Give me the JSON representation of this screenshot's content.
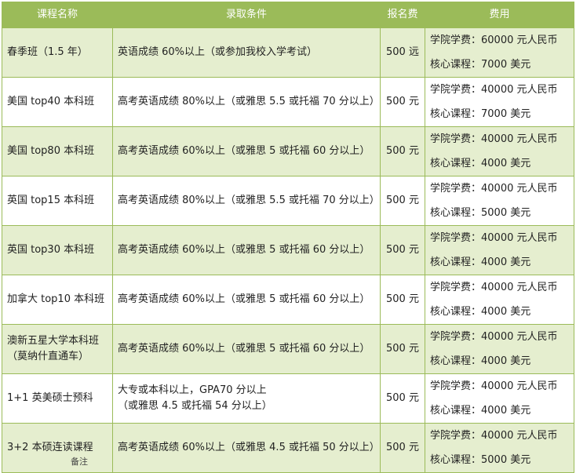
{
  "table": {
    "headers": [
      "课程名称",
      "录取条件",
      "报名费",
      "费用"
    ],
    "rows": [
      {
        "name": [
          "春季班（1.5 年）"
        ],
        "condition": [
          "英语成绩 60%以上（或参加我校入学考试）"
        ],
        "fee": "500 远",
        "costs": [
          "学院学费：60000 元人民币",
          "核心课程：7000 美元"
        ]
      },
      {
        "name": [
          "美国 top40 本科班"
        ],
        "condition": [
          "高考英语成绩 80%以上（或雅思 5.5 或托福 70 分以上）"
        ],
        "fee": "500 元",
        "costs": [
          "学院学费：40000 元人民币",
          "核心课程：7000 美元"
        ]
      },
      {
        "name": [
          "美国 top80 本科班"
        ],
        "condition": [
          "高考英语成绩 60%以上（或雅思 5 或托福 60 分以上）"
        ],
        "fee": "500 元",
        "costs": [
          "学院学费：40000 元人民币",
          "核心课程：4000 美元"
        ]
      },
      {
        "name": [
          "英国 top15 本科班"
        ],
        "condition": [
          "高考英语成绩 80%以上（或雅思 5.5 或托福 70 分以上）"
        ],
        "fee": "500 元",
        "costs": [
          "学院学费：40000 元人民币",
          "核心课程：5000 美元"
        ]
      },
      {
        "name": [
          "英国 top30 本科班"
        ],
        "condition": [
          "高考英语成绩 60%以上（或雅思 5 或托福 60 分以上）"
        ],
        "fee": "500 元",
        "costs": [
          "学院学费：40000 元人民币",
          "核心课程：4000 美元"
        ]
      },
      {
        "name": [
          "加拿大 top10 本科班"
        ],
        "condition": [
          "高考英语成绩 60%以上（或雅思 5 或托福 60 分以上）"
        ],
        "fee": "500 元",
        "costs": [
          "学院学费：40000 元人民币",
          "核心课程：4000 美元"
        ]
      },
      {
        "name": [
          "澳新五星大学本科班",
          "（莫纳什直通车）"
        ],
        "condition": [
          "高考英语成绩 60%以上（或雅思 5 或托福 60 分以上）"
        ],
        "fee": "500 元",
        "costs": [
          "学院学费：40000 元人民币",
          "核心课程：4000 美元"
        ]
      },
      {
        "name": [
          "1+1 英美硕士预科"
        ],
        "condition": [
          "大专或本科以上，GPA70 分以上",
          "（或雅思 4.5 或托福 54 分以上）"
        ],
        "fee": "500 元",
        "costs": [
          "学院学费：40000 元人民币",
          "核心课程：4000 美元"
        ]
      },
      {
        "name": [
          "3+2 本硕连读课程"
        ],
        "condition": [
          "高考英语成绩 60%以上（或雅思 4.5 或托福 50 分以上）"
        ],
        "fee": "500 元",
        "costs": [
          "学院学费：40000 元人民币",
          "核心课程：5000 美元"
        ]
      }
    ]
  },
  "footer_note": "备注"
}
